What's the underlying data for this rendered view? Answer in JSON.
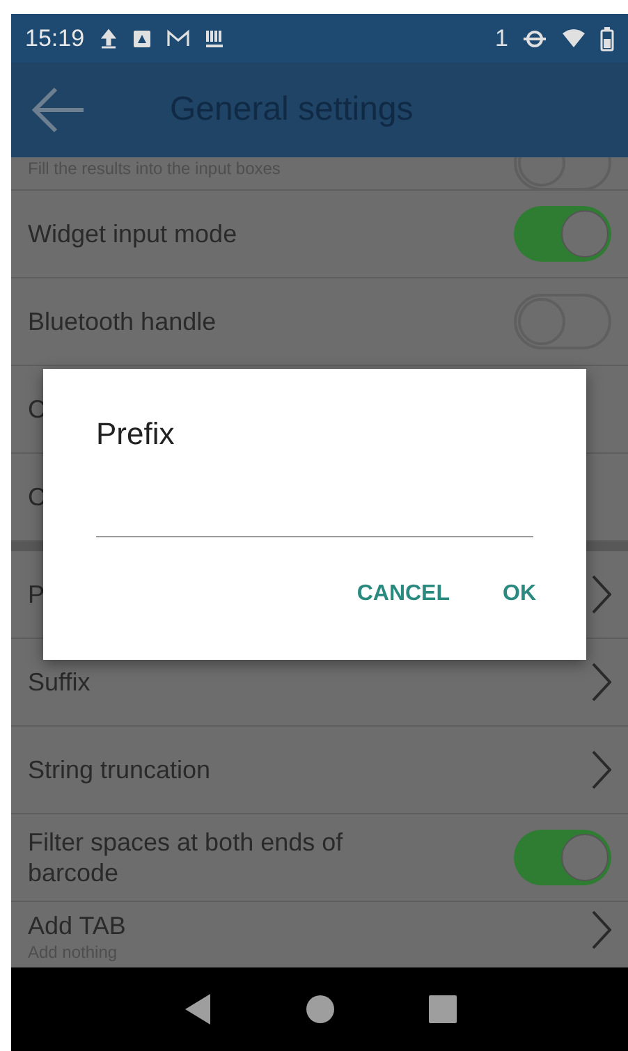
{
  "status_bar": {
    "time": "15:19",
    "sim_label": "1"
  },
  "app_bar": {
    "title": "General settings"
  },
  "settings": [
    {
      "kind": "toggle",
      "subtitle": "Fill the results into the input boxes",
      "on": false,
      "clipped": true,
      "group_start": false
    },
    {
      "kind": "toggle",
      "label": "Widget input mode",
      "on": true,
      "clipped": false,
      "group_start": false
    },
    {
      "kind": "toggle",
      "label": "Bluetooth handle",
      "on": false,
      "clipped": false,
      "group_start": false
    },
    {
      "kind": "plain",
      "label": "C",
      "clipped": false,
      "group_start": false
    },
    {
      "kind": "plain",
      "label": "C",
      "clipped": false,
      "group_start": false
    },
    {
      "kind": "link",
      "label": "P",
      "clipped": false,
      "group_start": true
    },
    {
      "kind": "link",
      "label": "Suffix",
      "clipped": false,
      "group_start": false
    },
    {
      "kind": "link",
      "label": "String truncation",
      "clipped": false,
      "group_start": false
    },
    {
      "kind": "toggle",
      "label": "Filter spaces at both ends of barcode",
      "on": true,
      "clipped": false,
      "group_start": false
    },
    {
      "kind": "link",
      "label": "Add TAB",
      "subtitle": "Add nothing",
      "clipped": false,
      "group_start": false
    }
  ],
  "dialog": {
    "title": "Prefix",
    "buttons": [
      "CANCEL",
      "OK"
    ]
  }
}
